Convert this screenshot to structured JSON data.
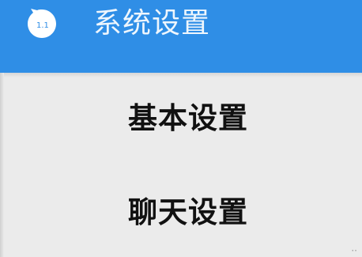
{
  "window": {
    "title": "系统设置",
    "app_icon": "app-logo-icon",
    "accent_color": "#2f8ee6"
  },
  "menu": {
    "items": [
      {
        "label": "基本设置"
      },
      {
        "label": "聊天设置"
      }
    ]
  },
  "corner_mark": "··"
}
